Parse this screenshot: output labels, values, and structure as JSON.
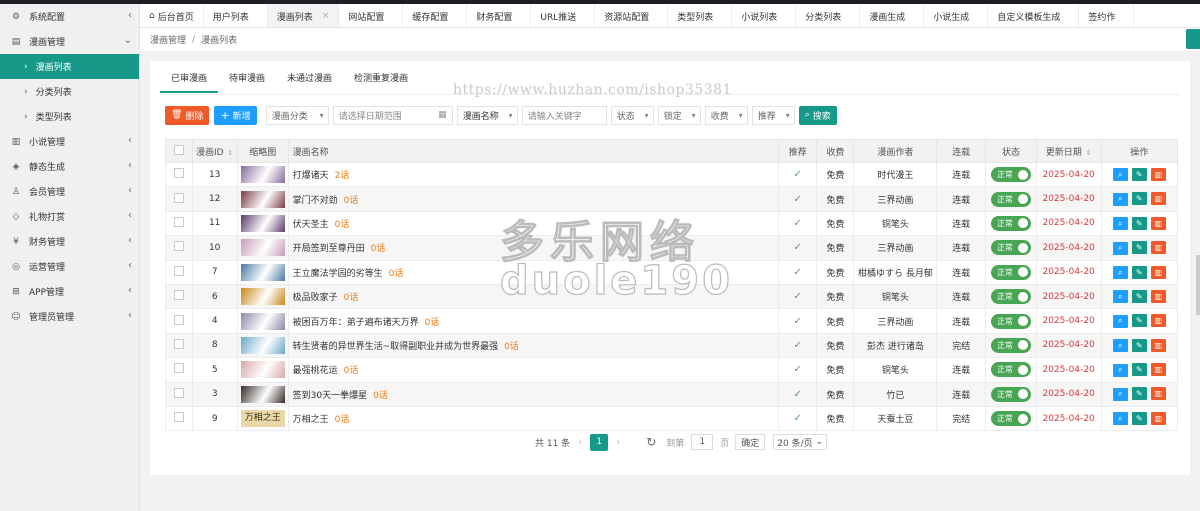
{
  "sidebar": {
    "items": [
      {
        "label": "系统配置",
        "icon": "settings-icon",
        "expanded": false
      },
      {
        "label": "漫画管理",
        "icon": "book-icon",
        "expanded": true,
        "children": [
          {
            "label": "漫画列表",
            "active": true
          },
          {
            "label": "分类列表",
            "active": false
          },
          {
            "label": "类型列表",
            "active": false
          }
        ]
      },
      {
        "label": "小说管理",
        "icon": "open-book-icon",
        "expanded": false
      },
      {
        "label": "静态生成",
        "icon": "cube-icon",
        "expanded": false
      },
      {
        "label": "会员管理",
        "icon": "users-icon",
        "expanded": false
      },
      {
        "label": "礼物打赏",
        "icon": "diamond-icon",
        "expanded": false
      },
      {
        "label": "财务管理",
        "icon": "money-icon",
        "expanded": false
      },
      {
        "label": "运营管理",
        "icon": "globe-icon",
        "expanded": false
      },
      {
        "label": "APP管理",
        "icon": "windows-icon",
        "expanded": false
      },
      {
        "label": "管理员管理",
        "icon": "user-icon",
        "expanded": false
      }
    ]
  },
  "tabs": [
    {
      "label": "后台首页",
      "home": true
    },
    {
      "label": "用户列表"
    },
    {
      "label": "漫画列表",
      "active": true
    },
    {
      "label": "网站配置"
    },
    {
      "label": "缓存配置"
    },
    {
      "label": "财务配置"
    },
    {
      "label": "URL推送"
    },
    {
      "label": "资源站配置"
    },
    {
      "label": "类型列表"
    },
    {
      "label": "小说列表"
    },
    {
      "label": "分类列表"
    },
    {
      "label": "漫画生成"
    },
    {
      "label": "小说生成"
    },
    {
      "label": "自定义模板生成"
    },
    {
      "label": "签约作"
    }
  ],
  "breadcrumb": [
    "漫画管理",
    "漫画列表"
  ],
  "content_tabs": [
    "已审漫画",
    "待审漫画",
    "未通过漫画",
    "检测重复漫画"
  ],
  "toolbar": {
    "delete_label": "删除",
    "add_label": "新增",
    "category_select": "漫画分类",
    "date_placeholder": "请选择日期范围",
    "field_select": "漫画名称",
    "keyword_placeholder": "请输入关键字",
    "status_select": "状态",
    "lock_select": "锁定",
    "fee_select": "收费",
    "recommend_select": "推荐",
    "search_label": "搜索"
  },
  "table": {
    "headers": {
      "id": "漫画ID",
      "thumb": "缩略图",
      "name": "漫画名称",
      "recommend": "推荐",
      "fee": "收费",
      "author": "漫画作者",
      "serial": "连载",
      "status": "状态",
      "updated": "更新日期",
      "actions": "操作"
    },
    "rows": [
      {
        "id": "13",
        "name": "打爆诸天",
        "chapters": "2话",
        "fee": "免费",
        "author": "时代漫王",
        "serial": "连载",
        "status": "正常",
        "updated": "2025-04-20",
        "thumb_color": "#8a6a9e"
      },
      {
        "id": "12",
        "name": "掌门不对劲",
        "chapters": "0话",
        "fee": "免费",
        "author": "三界动画",
        "serial": "连载",
        "status": "正常",
        "updated": "2025-04-20",
        "thumb_color": "#7a3a48"
      },
      {
        "id": "11",
        "name": "伏天圣主",
        "chapters": "0话",
        "fee": "免费",
        "author": "铜笔头",
        "serial": "连载",
        "status": "正常",
        "updated": "2025-04-20",
        "thumb_color": "#5a3a6a"
      },
      {
        "id": "10",
        "name": "开局签到至尊丹田",
        "chapters": "0话",
        "fee": "免费",
        "author": "三界动画",
        "serial": "连载",
        "status": "正常",
        "updated": "2025-04-20",
        "thumb_color": "#c89ab8"
      },
      {
        "id": "7",
        "name": "王立魔法学园的劣等生",
        "chapters": "0话",
        "fee": "免费",
        "author": "柑橘ゆすら 長月郁",
        "serial": "连载",
        "status": "正常",
        "updated": "2025-04-20",
        "thumb_color": "#4a7aa8"
      },
      {
        "id": "6",
        "name": "极品败家子",
        "chapters": "0话",
        "fee": "免费",
        "author": "铜笔头",
        "serial": "连载",
        "status": "正常",
        "updated": "2025-04-20",
        "thumb_color": "#c8881a"
      },
      {
        "id": "4",
        "name": "被困百万年：弟子遍布诸天万界",
        "chapters": "0话",
        "fee": "免费",
        "author": "三界动画",
        "serial": "连载",
        "status": "正常",
        "updated": "2025-04-20",
        "thumb_color": "#8a8aa8"
      },
      {
        "id": "8",
        "name": "转生贤者的异世界生活~取得副职业并成为世界最强",
        "chapters": "0话",
        "fee": "免费",
        "author": "彭杰 进行诸岛",
        "serial": "完结",
        "status": "正常",
        "updated": "2025-04-20",
        "thumb_color": "#6aa8c8"
      },
      {
        "id": "5",
        "name": "最强桃花运",
        "chapters": "0话",
        "fee": "免费",
        "author": "铜笔头",
        "serial": "连载",
        "status": "正常",
        "updated": "2025-04-20",
        "thumb_color": "#d8a8a8"
      },
      {
        "id": "3",
        "name": "签到30天一拳爆星",
        "chapters": "0话",
        "fee": "免费",
        "author": "竹已",
        "serial": "连载",
        "status": "正常",
        "updated": "2025-04-20",
        "thumb_color": "#3a2a2a"
      },
      {
        "id": "9",
        "name": "万相之王",
        "chapters": "0话",
        "fee": "免费",
        "author": "天蚕土豆",
        "serial": "完结",
        "status": "正常",
        "updated": "2025-04-20",
        "thumb_color": "#e8d8a8",
        "thumb_text": "万相之王"
      }
    ]
  },
  "pagination": {
    "total": "共 11 条",
    "current": "1",
    "goto_label": "到第",
    "goto_value": "1",
    "page_unit": "页",
    "confirm_label": "确定",
    "page_size": "20 条/页"
  },
  "watermark": {
    "url": "https://www.huzhan.com/ishop35381",
    "brand_cn": "多乐网络",
    "brand_en": "duole190"
  },
  "colors": {
    "primary": "#17998a",
    "danger": "#f05a28",
    "info": "#1e9fff",
    "date": "#d63a3a",
    "chapters": "#f07a15"
  }
}
